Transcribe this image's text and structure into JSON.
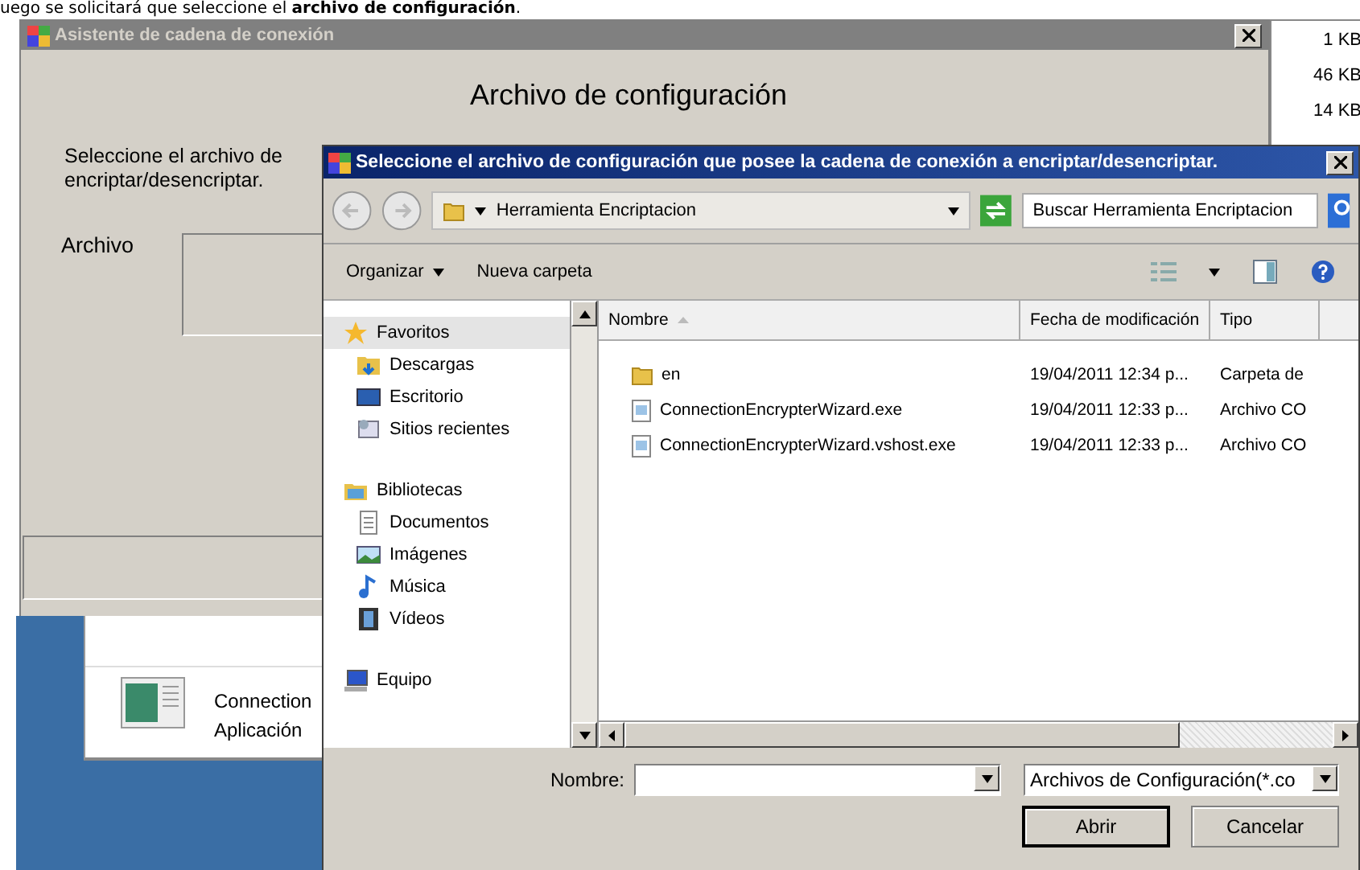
{
  "caption": "uego se solicitará que seleccione el **archivo de configuración**.",
  "size_column": [
    "1 KB",
    "46 KB",
    "14 KB"
  ],
  "wizard": {
    "title": "Asistente de cadena de conexión",
    "heading": "Archivo de configuración",
    "instruction_lines": [
      "Seleccione el archivo de",
      "encriptar/desencriptar."
    ],
    "file_label": "Archivo"
  },
  "explorer_item": {
    "name": "Connection",
    "type": "Aplicación"
  },
  "dialog": {
    "title": "Seleccione el archivo de configuración que posee la cadena de conexión a encriptar/desencriptar.",
    "breadcrumb": "Herramienta Encriptacion",
    "search": {
      "placeholder": "Buscar Herramienta Encriptacion"
    },
    "toolbar": [
      {
        "label": "Organizar",
        "kind": "menu"
      },
      {
        "label": "Nueva carpeta",
        "kind": "button"
      }
    ],
    "nav": [
      {
        "label": "Favoritos",
        "selected": true,
        "children": [
          {
            "label": "Descargas",
            "selected": false
          },
          {
            "label": "Escritorio",
            "selected": false
          },
          {
            "label": "Sitios recientes",
            "selected": false
          }
        ]
      },
      {
        "label": "Bibliotecas",
        "selected": false,
        "children": [
          {
            "label": "Documentos",
            "selected": false
          },
          {
            "label": "Imágenes",
            "selected": false
          },
          {
            "label": "Música",
            "selected": false
          },
          {
            "label": "Vídeos",
            "selected": false
          }
        ]
      },
      {
        "label": "Equipo",
        "selected": false
      }
    ],
    "columns": [
      {
        "label": "Nombre",
        "sorted": true
      },
      {
        "label": "Fecha de modificación",
        "sorted": false
      },
      {
        "label": "Tipo",
        "sorted": false
      }
    ],
    "files": [
      {
        "kind": "folder",
        "name": "en",
        "modified": "19/04/2011 12:34 p...",
        "type": "Carpeta de"
      },
      {
        "kind": "file",
        "name": "ConnectionEncrypterWizard.exe",
        "modified": "19/04/2011 12:33 p...",
        "type": "Archivo CO"
      },
      {
        "kind": "file",
        "name": "ConnectionEncrypterWizard.vshost.exe",
        "modified": "19/04/2011 12:33 p...",
        "type": "Archivo CO"
      }
    ],
    "filename_label": "Nombre:",
    "file_type": "Archivos de Configuración(*.co",
    "buttons": [
      {
        "label": "Abrir",
        "default": true
      },
      {
        "label": "Cancelar",
        "default": false
      }
    ]
  }
}
